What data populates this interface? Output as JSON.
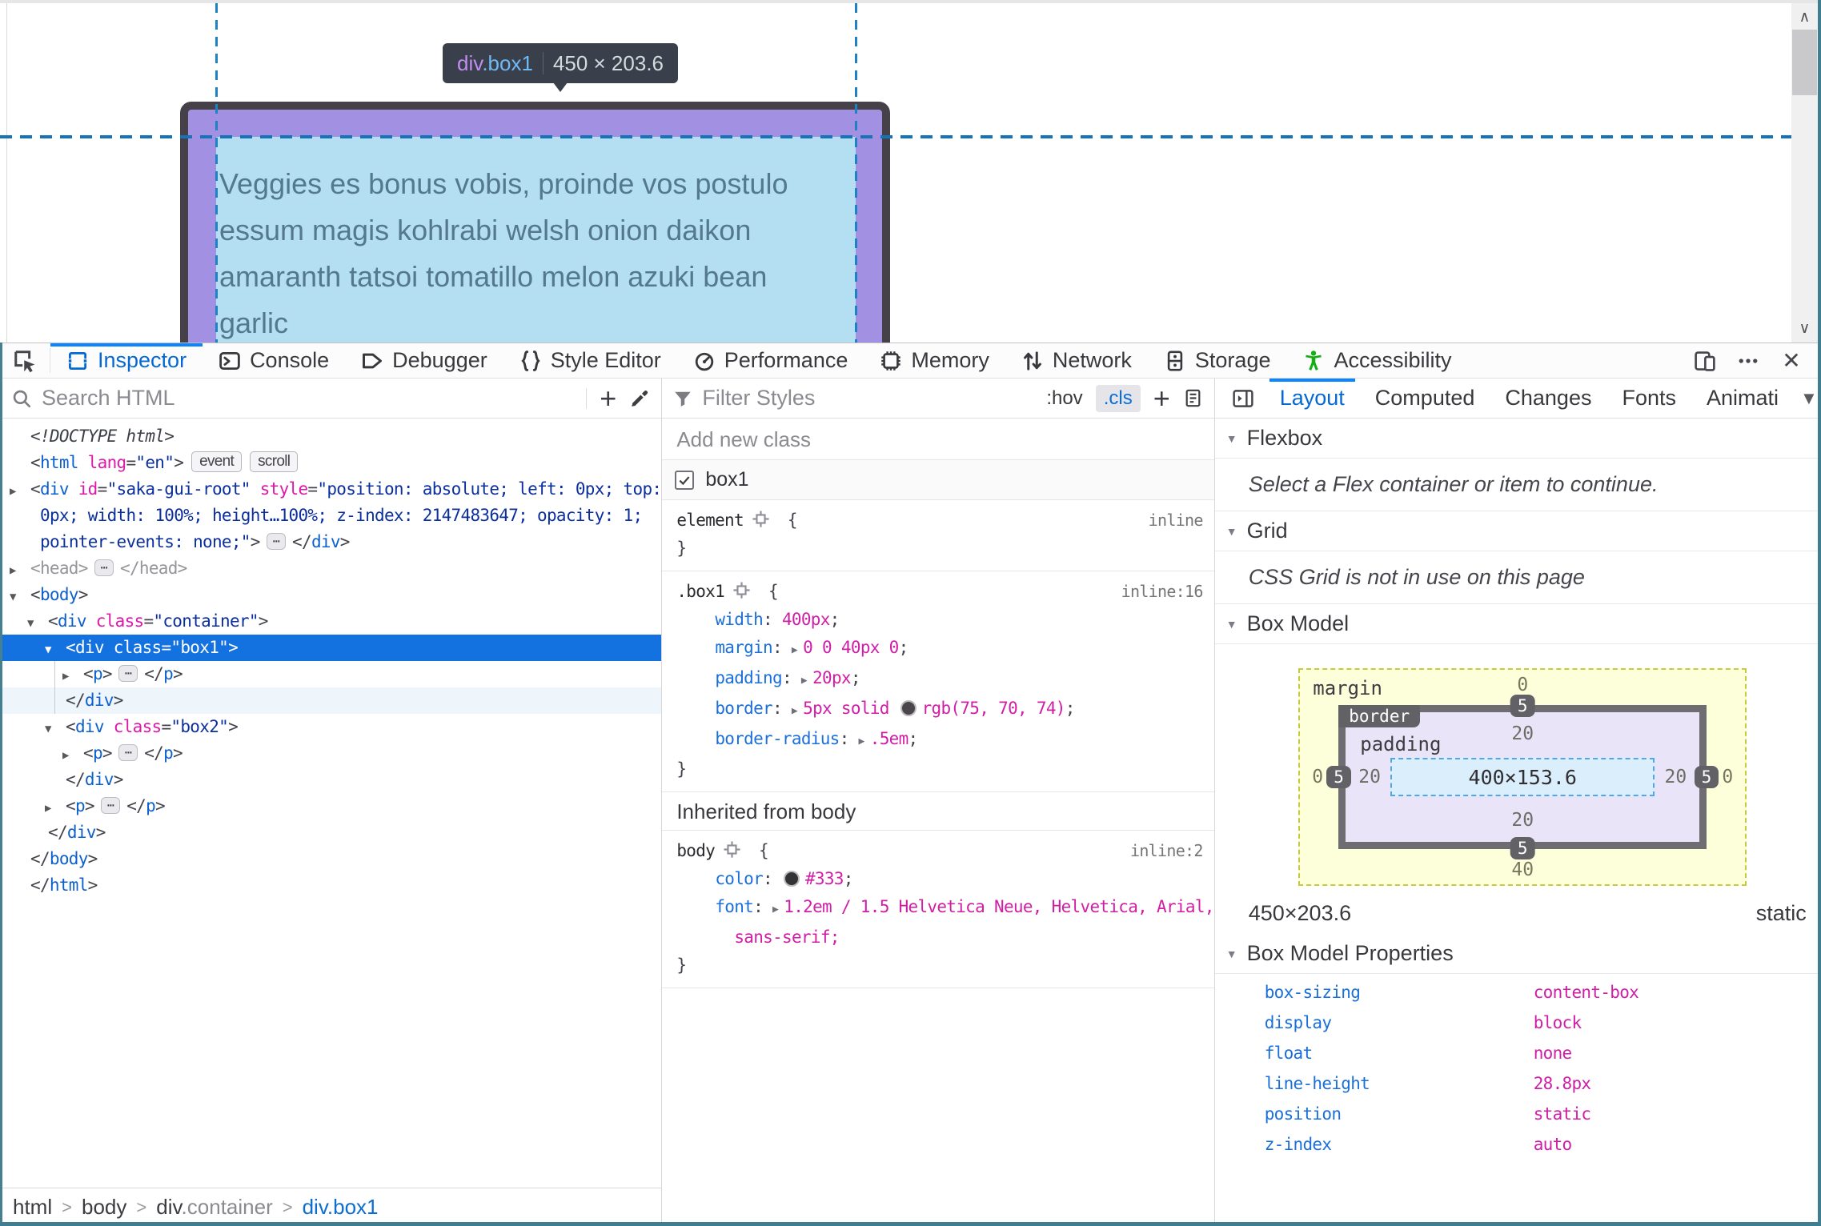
{
  "page": {
    "tooltip": {
      "tag": "div",
      "cls": ".box1",
      "dims": "450 × 203.6"
    },
    "box_text_lines": [
      "Veggies es bonus vobis, proinde vos postulo",
      "essum magis kohlrabi welsh onion daikon",
      "amaranth tatsoi tomatillo melon azuki bean",
      "garlic"
    ]
  },
  "toolbar": {
    "tabs": [
      {
        "label": "Inspector"
      },
      {
        "label": "Console"
      },
      {
        "label": "Debugger"
      },
      {
        "label": "Style Editor"
      },
      {
        "label": "Performance"
      },
      {
        "label": "Memory"
      },
      {
        "label": "Network"
      },
      {
        "label": "Storage"
      },
      {
        "label": "Accessibility"
      }
    ]
  },
  "markup": {
    "search_placeholder": "Search HTML",
    "rows": [
      {
        "lvl": 0,
        "tokens": [
          [
            "doct",
            "<!DOCTYPE html>"
          ]
        ]
      },
      {
        "lvl": 0,
        "tokens": [
          [
            "punc",
            "<"
          ],
          [
            "tag",
            "html"
          ],
          [
            "attr",
            " lang"
          ],
          [
            "punc",
            "="
          ],
          [
            "val",
            "\"en\""
          ],
          [
            "punc",
            ">"
          ]
        ],
        "chips": [
          "event",
          "scroll"
        ]
      },
      {
        "lvl": 0,
        "tri": "▶",
        "tokens": [
          [
            "punc",
            "<"
          ],
          [
            "tag",
            "div"
          ],
          [
            "attr",
            " id"
          ],
          [
            "punc",
            "="
          ],
          [
            "val",
            "\"saka-gui-root\""
          ],
          [
            "attr",
            " style"
          ],
          [
            "punc",
            "="
          ],
          [
            "val",
            "\"position: absolute; left: 0px; top:"
          ]
        ]
      },
      {
        "lvl": 0,
        "cont": true,
        "tokens": [
          [
            "val",
            "0px; width: 100%; height…100%; z-index: 2147483647; opacity: 1;"
          ]
        ]
      },
      {
        "lvl": 0,
        "cont": true,
        "tokens": [
          [
            "val",
            "pointer-events: none;\""
          ],
          [
            "punc",
            ">"
          ],
          [
            "ell",
            ""
          ],
          [
            "punc",
            "</"
          ],
          [
            "tag",
            "div"
          ],
          [
            "punc",
            ">"
          ]
        ]
      },
      {
        "lvl": 0,
        "tri": "▶",
        "tokens": [
          [
            "gray",
            "<head>"
          ],
          [
            "ell",
            ""
          ],
          [
            "gray",
            "</head>"
          ]
        ]
      },
      {
        "lvl": 0,
        "tri": "▼",
        "tokens": [
          [
            "punc",
            "<"
          ],
          [
            "tag",
            "body"
          ],
          [
            "punc",
            ">"
          ]
        ]
      },
      {
        "lvl": 1,
        "tri": "▼",
        "tokens": [
          [
            "punc",
            "<"
          ],
          [
            "tag",
            "div"
          ],
          [
            "attr",
            " class"
          ],
          [
            "punc",
            "="
          ],
          [
            "val",
            "\"container\""
          ],
          [
            "punc",
            ">"
          ]
        ]
      },
      {
        "lvl": 2,
        "tri": "▼",
        "sel": true,
        "tokens": [
          [
            "punc",
            "<"
          ],
          [
            "tag",
            "div"
          ],
          [
            "attr",
            " class"
          ],
          [
            "punc",
            "="
          ],
          [
            "val",
            "\"box1\""
          ],
          [
            "punc",
            ">"
          ]
        ]
      },
      {
        "lvl": 3,
        "tri": "▶",
        "guide": true,
        "tokens": [
          [
            "punc",
            "<"
          ],
          [
            "tag",
            "p"
          ],
          [
            "punc",
            ">"
          ],
          [
            "ell",
            ""
          ],
          [
            "punc",
            "</"
          ],
          [
            "tag",
            "p"
          ],
          [
            "punc",
            ">"
          ]
        ]
      },
      {
        "lvl": 2,
        "close": true,
        "subsel": true,
        "guide": true,
        "tokens": [
          [
            "punc",
            "</"
          ],
          [
            "tag",
            "div"
          ],
          [
            "punc",
            ">"
          ]
        ]
      },
      {
        "lvl": 2,
        "tri": "▼",
        "tokens": [
          [
            "punc",
            "<"
          ],
          [
            "tag",
            "div"
          ],
          [
            "attr",
            " class"
          ],
          [
            "punc",
            "="
          ],
          [
            "val",
            "\"box2\""
          ],
          [
            "punc",
            ">"
          ]
        ]
      },
      {
        "lvl": 3,
        "tri": "▶",
        "tokens": [
          [
            "punc",
            "<"
          ],
          [
            "tag",
            "p"
          ],
          [
            "punc",
            ">"
          ],
          [
            "ell",
            ""
          ],
          [
            "punc",
            "</"
          ],
          [
            "tag",
            "p"
          ],
          [
            "punc",
            ">"
          ]
        ]
      },
      {
        "lvl": 2,
        "close": true,
        "tokens": [
          [
            "punc",
            "</"
          ],
          [
            "tag",
            "div"
          ],
          [
            "punc",
            ">"
          ]
        ]
      },
      {
        "lvl": 2,
        "tri": "▶",
        "tokens": [
          [
            "punc",
            "<"
          ],
          [
            "tag",
            "p"
          ],
          [
            "punc",
            ">"
          ],
          [
            "ell",
            ""
          ],
          [
            "punc",
            "</"
          ],
          [
            "tag",
            "p"
          ],
          [
            "punc",
            ">"
          ]
        ]
      },
      {
        "lvl": 1,
        "close": true,
        "tokens": [
          [
            "punc",
            "</"
          ],
          [
            "tag",
            "div"
          ],
          [
            "punc",
            ">"
          ]
        ]
      },
      {
        "lvl": 0,
        "close": true,
        "tokens": [
          [
            "punc",
            "</"
          ],
          [
            "tag",
            "body"
          ],
          [
            "punc",
            ">"
          ]
        ]
      },
      {
        "lvl": 0,
        "close": true,
        "tokens": [
          [
            "punc",
            "</"
          ],
          [
            "tag",
            "html"
          ],
          [
            "punc",
            ">"
          ]
        ]
      }
    ],
    "breadcrumbs": [
      {
        "text": "html",
        "c": "dark"
      },
      {
        "text": "body",
        "c": "dark"
      },
      {
        "text": "div",
        "c": "dark",
        "suffix": ".container"
      },
      {
        "text": "div.box1",
        "c": "blue"
      }
    ]
  },
  "rules": {
    "filter_placeholder": "Filter Styles",
    "pseudo_toggle": ":hov",
    "class_toggle": ".cls",
    "add_class_placeholder": "Add new class",
    "class_checkbox_label": "box1",
    "sections": [
      {
        "type": "block",
        "selector": "element",
        "meta": "inline",
        "lines": []
      },
      {
        "type": "block",
        "selector": ".box1",
        "meta": "inline:16",
        "lines": [
          {
            "prop": "width",
            "value": [
              {
                "t": "400px"
              }
            ]
          },
          {
            "prop": "margin",
            "tri": true,
            "value": [
              {
                "t": "0 0 40px 0"
              }
            ]
          },
          {
            "prop": "padding",
            "tri": true,
            "value": [
              {
                "t": "20px"
              }
            ]
          },
          {
            "prop": "border",
            "tri": true,
            "value": [
              {
                "t": "5px solid "
              },
              {
                "swatch": "#4b464a"
              },
              {
                "t": "rgb(75, 70, 74)"
              }
            ]
          },
          {
            "prop": "border-radius",
            "tri": true,
            "value": [
              {
                "t": ".5em"
              }
            ]
          }
        ]
      },
      {
        "type": "header",
        "text": "Inherited from body"
      },
      {
        "type": "block",
        "selector": "body",
        "meta": "inline:2",
        "lines": [
          {
            "prop": "color",
            "value": [
              {
                "swatch": "#333333"
              },
              {
                "t": "#333"
              }
            ]
          },
          {
            "prop": "font",
            "tri": true,
            "value": [
              {
                "t": "1.2em / 1.5 Helvetica Neue, Helvetica, Arial,"
              }
            ],
            "cont": "sans-serif;"
          }
        ]
      }
    ]
  },
  "layout": {
    "tabs": [
      "Layout",
      "Computed",
      "Changes",
      "Fonts",
      "Animati"
    ],
    "flexbox": {
      "title": "Flexbox",
      "message": "Select a Flex container or item to continue."
    },
    "grid": {
      "title": "Grid",
      "message": "CSS Grid is not in use on this page"
    },
    "boxmodel": {
      "title": "Box Model",
      "labels": {
        "margin": "margin",
        "border": "border",
        "padding": "padding"
      },
      "margin": {
        "top": "0",
        "right": "0",
        "bottom": "40",
        "left": "0"
      },
      "border": {
        "top": "5",
        "right": "5",
        "bottom": "5",
        "left": "5"
      },
      "padding": {
        "top": "20",
        "right": "20",
        "bottom": "20",
        "left": "20"
      },
      "content": "400×153.6",
      "dims": "450×203.6",
      "position": "static"
    },
    "properties": {
      "title": "Box Model Properties",
      "items": [
        [
          "box-sizing",
          "content-box"
        ],
        [
          "display",
          "block"
        ],
        [
          "float",
          "none"
        ],
        [
          "line-height",
          "28.8px"
        ],
        [
          "position",
          "static"
        ],
        [
          "z-index",
          "auto"
        ]
      ]
    }
  }
}
